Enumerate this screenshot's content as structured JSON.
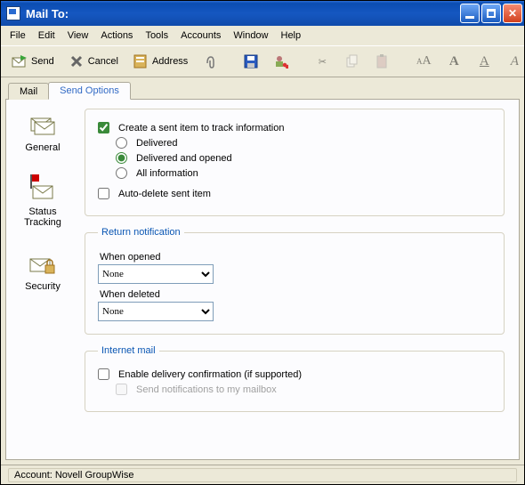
{
  "window": {
    "title": "Mail To:"
  },
  "menu": {
    "items": [
      "File",
      "Edit",
      "View",
      "Actions",
      "Tools",
      "Accounts",
      "Window",
      "Help"
    ]
  },
  "toolbar": {
    "send": "Send",
    "cancel": "Cancel",
    "address": "Address"
  },
  "tabs": {
    "mail": "Mail",
    "send_options": "Send Options"
  },
  "side": {
    "general": "General",
    "status_tracking": "Status\nTracking",
    "security": "Security"
  },
  "tracking": {
    "create_sent": "Create a sent item to track information",
    "create_sent_checked": true,
    "opt_delivered": "Delivered",
    "opt_delivered_opened": "Delivered and opened",
    "opt_allinfo": "All information",
    "selected": "delivered_opened",
    "auto_delete": "Auto-delete sent item",
    "auto_delete_checked": false
  },
  "return_notif": {
    "legend": "Return notification",
    "when_opened": "When opened",
    "opened_value": "None",
    "when_deleted": "When deleted",
    "deleted_value": "None"
  },
  "internet_mail": {
    "legend": "Internet mail",
    "enable_delivery_conf": "Enable delivery confirmation (if supported)",
    "enable_checked": false,
    "send_notif": "Send notifications to my mailbox"
  },
  "status": {
    "account": "Account: Novell GroupWise"
  }
}
